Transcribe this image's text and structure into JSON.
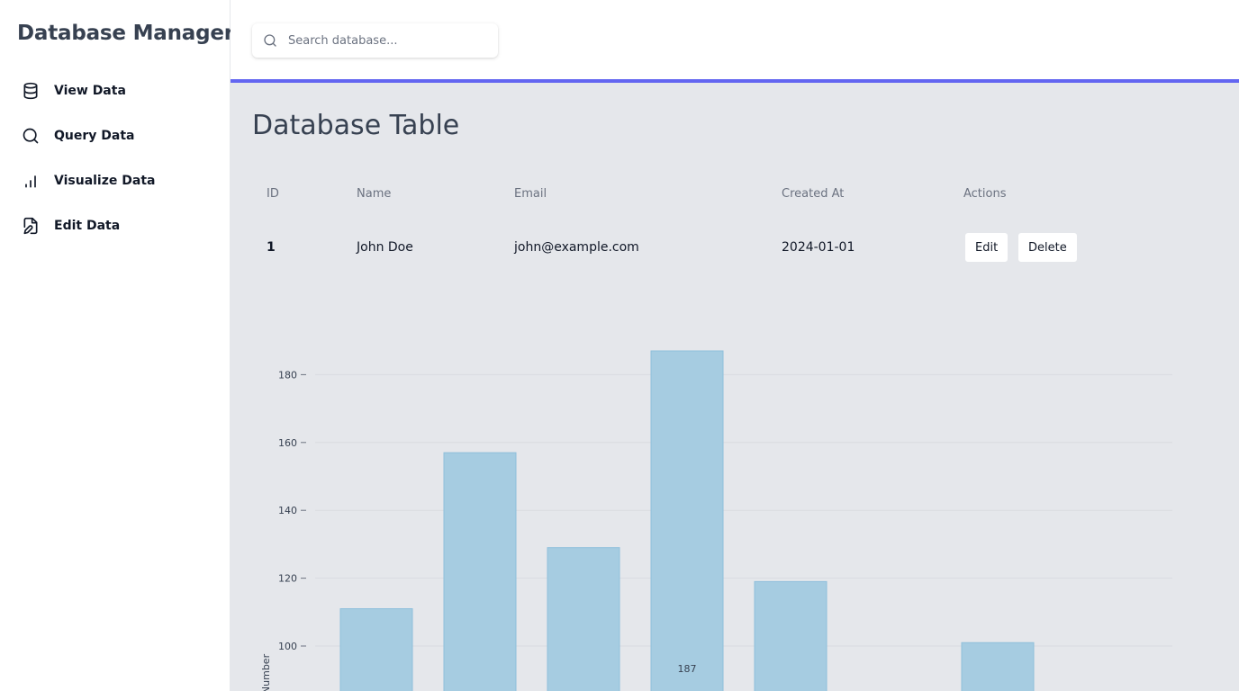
{
  "sidebar": {
    "title": "Database Manager",
    "items": [
      {
        "label": "View Data",
        "icon": "database-icon"
      },
      {
        "label": "Query Data",
        "icon": "search-icon"
      },
      {
        "label": "Visualize Data",
        "icon": "bar-chart-icon"
      },
      {
        "label": "Edit Data",
        "icon": "file-edit-icon"
      }
    ]
  },
  "search": {
    "placeholder": "Search database..."
  },
  "colors": {
    "accent": "#6366f1",
    "bar_fill": "#a6cce1",
    "bar_stroke": "#8fbfdb",
    "main_bg": "#e5e7eb"
  },
  "main": {
    "title": "Database Table",
    "table": {
      "headers": [
        "ID",
        "Name",
        "Email",
        "Created At",
        "Actions"
      ],
      "rows": [
        {
          "id": "1",
          "name": "John Doe",
          "email": "john@example.com",
          "created_at": "2024-01-01"
        }
      ],
      "actions": {
        "edit": "Edit",
        "delete": "Delete"
      }
    }
  },
  "chart_data": {
    "type": "bar",
    "values": [
      111,
      157,
      129,
      187,
      119,
      null,
      101
    ],
    "ylabel": "Number",
    "yticks": [
      100,
      120,
      140,
      160,
      180
    ],
    "grid": true,
    "annotation": "187"
  }
}
